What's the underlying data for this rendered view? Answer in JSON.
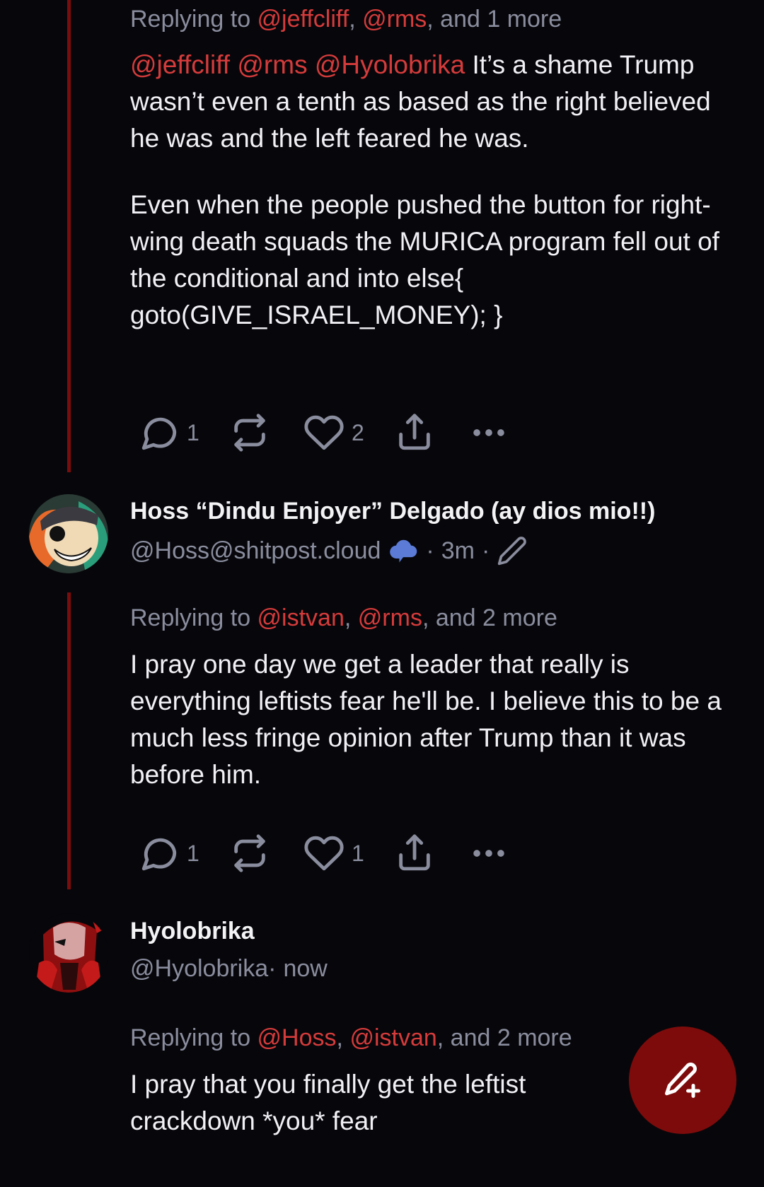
{
  "posts": [
    {
      "reply": {
        "prefix": "Replying to ",
        "m1": "@jeffcliff",
        "sep": ", ",
        "m2": "@rms",
        "suffix": ", and 1 more"
      },
      "body": {
        "mentions": "@jeffcliff @rms @Hyolobrika",
        "p1": " It’s a shame Trump wasn’t even a tenth as based as the right believed he was and the left feared he was.",
        "p2": "Even when the people pushed the button for right-wing death squads the MURICA program fell out of the conditional and into else{ goto(GIVE_ISRAEL_MONEY); }"
      },
      "actions": {
        "reply_count": "1",
        "like_count": "2"
      }
    },
    {
      "name": "Hoss “Dindu Enjoyer” Delgado (ay dios mio!!)",
      "handle": "@Hoss@shitpost.cloud",
      "meta_sep1": " · ",
      "time": "3m",
      "meta_sep2": " · ",
      "reply": {
        "prefix": "Replying to ",
        "m1": "@istvan",
        "sep": ", ",
        "m2": "@rms",
        "suffix": ", and 2 more"
      },
      "body": {
        "p1": "I pray one day we get a leader that really is everything leftists fear he'll be. I believe this to be a much less fringe opinion after Trump than it was before him."
      },
      "actions": {
        "reply_count": "1",
        "like_count": "1"
      }
    },
    {
      "name": "Hyolobrika",
      "handle": "@Hyolobrika",
      "meta_sep1": " · ",
      "time": "now",
      "reply": {
        "prefix": "Replying to ",
        "m1": "@Hoss",
        "sep": ", ",
        "m2": "@istvan",
        "suffix": ", and 2 more"
      },
      "body": {
        "p1": "I pray that you finally get the leftist crackdown *you* fear"
      }
    }
  ],
  "icons": {
    "reply": "chat-bubble-icon",
    "boost": "repost-icon",
    "like": "heart-icon",
    "share": "share-icon",
    "more": "more-dots-icon",
    "instance": "cloud-icon",
    "edited": "pencil-icon",
    "compose": "compose-icon"
  },
  "colors": {
    "accent": "#d63b3b",
    "fab": "#7e0b0b",
    "thread": "#7a0d0d",
    "muted": "#8a8d9e",
    "background": "#07070b"
  }
}
